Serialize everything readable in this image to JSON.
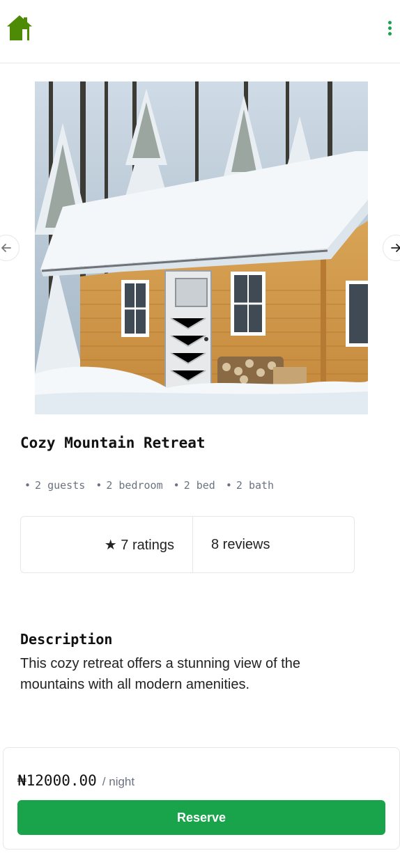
{
  "header": {
    "logo_icon": "house-icon",
    "menu_icon": "kebab-menu-icon",
    "accent_color": "#16a34a"
  },
  "carousel": {
    "image_alt": "Snow-covered wooden cabin in a pine forest",
    "prev_icon": "arrow-left-icon",
    "next_icon": "arrow-right-icon"
  },
  "listing": {
    "title": "Cozy Mountain Retreat",
    "features": [
      "2 guests",
      "2 bedroom",
      "2 bed",
      "2 bath"
    ],
    "ratings_label": "★ 7 ratings",
    "reviews_label": "8 reviews"
  },
  "description": {
    "heading": "Description",
    "body": "This cozy retreat offers a stunning view of the mountains with all modern amenities."
  },
  "booking": {
    "price": "₦12000.00",
    "unit": "/ night",
    "reserve_label": "Reserve",
    "button_color": "#19a34a"
  }
}
